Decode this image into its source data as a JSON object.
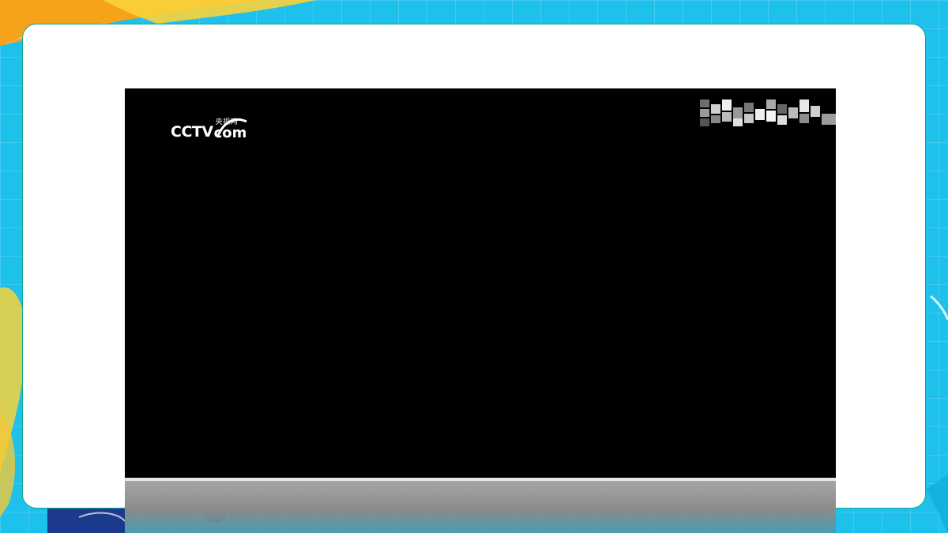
{
  "colors": {
    "background": "#1ec0ec",
    "card": "#ffffff",
    "card_border": "#14a98c",
    "video": "#000000",
    "accent_orange": "#f7a21b",
    "accent_yellow": "#f8d23c",
    "accent_navy": "#1b3a8c"
  },
  "video": {
    "logo": {
      "main": "CCTV",
      "cn": "央视网",
      "com": "com"
    },
    "watermark_icon": "pixelated-watermark-icon"
  },
  "controls": {
    "icon": "video-control-bar"
  }
}
